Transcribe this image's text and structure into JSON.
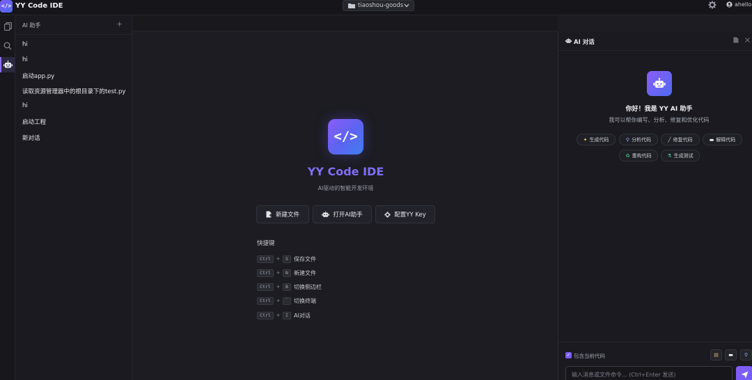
{
  "app": {
    "logo_glyph": "</>",
    "title": "YY Code IDE",
    "accent": "#7c5cf5"
  },
  "project": {
    "name": "tiaoshou-goods"
  },
  "user": {
    "name": "ahello"
  },
  "activity": {
    "active": "ai-assistant"
  },
  "sidebar": {
    "title": "AI 助手",
    "add": "+",
    "chats": [
      {
        "label": "hi"
      },
      {
        "label": "hi"
      },
      {
        "label": "启动app.py"
      },
      {
        "label": "读取资源管理器中的根目录下的test.py"
      },
      {
        "label": "hi"
      },
      {
        "label": "启动工程"
      },
      {
        "label": "新对话"
      }
    ]
  },
  "welcome": {
    "logo_glyph": "</>",
    "title": "YY Code IDE",
    "subtitle": "AI驱动的智能开发环境",
    "buttons": {
      "new_file": "新建文件",
      "open_ai": "打开AI助手",
      "config_key": "配置YY Key"
    },
    "shortcuts_title": "快捷键",
    "shortcuts": [
      {
        "mod": "Ctrl",
        "plus": "+",
        "key": "S",
        "label": "保存文件"
      },
      {
        "mod": "Ctrl",
        "plus": "+",
        "key": "N",
        "label": "新建文件"
      },
      {
        "mod": "Ctrl",
        "plus": "+",
        "key": "B",
        "label": "切换侧边栏"
      },
      {
        "mod": "Ctrl",
        "plus": "+",
        "key": "`",
        "label": "切换终端"
      },
      {
        "mod": "Ctrl",
        "plus": "+",
        "key": "I",
        "label": "AI对话"
      }
    ]
  },
  "chat": {
    "title": "AI 对话",
    "greeting": "你好！我是 YY AI 助手",
    "subtitle": "我可以帮你编写、分析、修复和优化代码",
    "chips": [
      {
        "icon": "sparkle-icon",
        "label": "生成代码"
      },
      {
        "icon": "magnifier-icon",
        "label": "分析代码"
      },
      {
        "icon": "wrench-icon",
        "label": "修复代码"
      },
      {
        "icon": "book-icon",
        "label": "解释代码"
      },
      {
        "icon": "recycle-icon",
        "label": "重构代码"
      },
      {
        "icon": "flask-icon",
        "label": "生成测试"
      }
    ],
    "include_code_label": "包含当前代码",
    "include_code_checked": true,
    "input_placeholder": "输入消息或文件命令... (Ctrl+Enter 发送)"
  }
}
